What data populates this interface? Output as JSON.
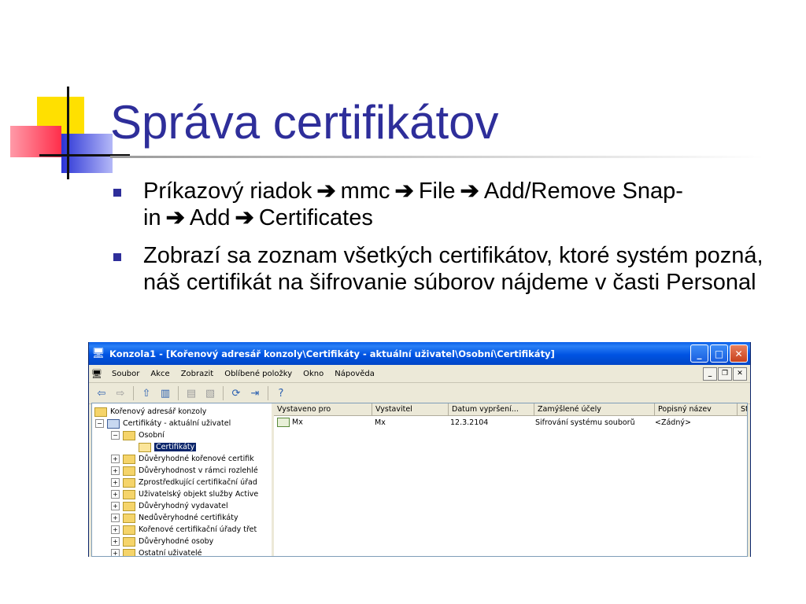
{
  "slide": {
    "title": "Správa certifikátov",
    "bullets": [
      {
        "parts": [
          "Príkazový riadok",
          "mmc",
          "File",
          "Add/Remove Snap-in",
          "Add",
          "Certificates"
        ]
      },
      {
        "text": "Zobrazí sa zoznam všetkých certifikátov, ktoré systém pozná, náš certifikát na šifrovanie súborov nájdeme v časti Personal"
      }
    ]
  },
  "window": {
    "title": "Konzola1 - [Kořenový adresář konzoly\\Certifikáty - aktuální uživatel\\Osobní\\Certifikáty]",
    "menu": [
      "Soubor",
      "Akce",
      "Zobrazit",
      "Oblíbené položky",
      "Okno",
      "Nápověda"
    ],
    "tree": {
      "root": "Kořenový adresář konzoly",
      "snapin": "Certifikáty - aktuální uživatel",
      "personal": "Osobní",
      "selected": "Certifikáty",
      "stores": [
        "Důvěryhodné kořenové certifik",
        "Důvěryhodnost v rámci rozlehlé",
        "Zprostředkující certifikační úřad",
        "Uživatelský objekt služby Active",
        "Důvěryhodný vydavatel",
        "Nedůvěryhodné certifikáty",
        "Kořenové certifikační úřady třet",
        "Důvěryhodné osoby",
        "Ostatní uživatelé"
      ]
    },
    "list": {
      "columns": [
        "Vystaveno pro",
        "Vystavitel",
        "Datum vypršení...",
        "Zamýšlené účely",
        "Popisný název",
        "Sta"
      ],
      "rows": [
        [
          "Mx",
          "Mx",
          "12.3.2104",
          "Šifrování systému souborů",
          "<Žádný>",
          ""
        ]
      ]
    }
  }
}
